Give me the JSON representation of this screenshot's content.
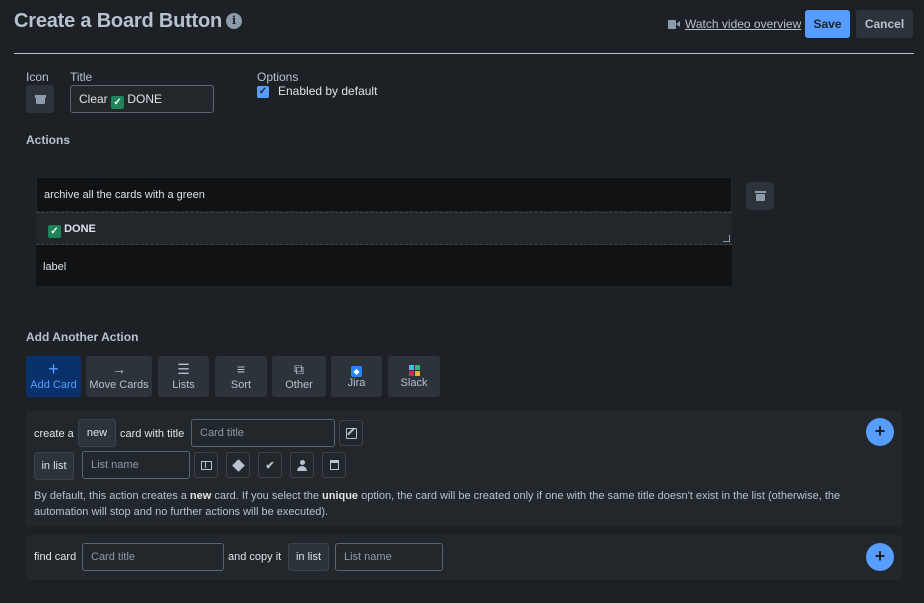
{
  "header": {
    "title": "Create a Board Button",
    "info_icon": "info-icon",
    "video_link": "Watch video overview",
    "save_label": "Save",
    "cancel_label": "Cancel"
  },
  "button_config": {
    "icon_label": "Icon",
    "icon_name": "archive-icon",
    "title_label": "Title",
    "title_value_prefix": "Clear",
    "title_value_suffix": "DONE",
    "options_label": "Options",
    "enabled_label": "Enabled by default",
    "enabled": true
  },
  "actions": {
    "heading": "Actions",
    "items": [
      {
        "line1": "archive all the cards with a green",
        "label_name": "DONE",
        "line3": "label"
      }
    ]
  },
  "add_action": {
    "heading": "Add Another Action",
    "tabs": [
      {
        "label": "Add Card",
        "icon": "plus-icon",
        "active": true
      },
      {
        "label": "Move Cards",
        "icon": "arrow-right-icon",
        "active": false
      },
      {
        "label": "Lists",
        "icon": "list-icon",
        "active": false
      },
      {
        "label": "Sort",
        "icon": "sort-icon",
        "active": false
      },
      {
        "label": "Other",
        "icon": "copy-icon",
        "active": false
      },
      {
        "label": "Jira",
        "icon": "jira-icon",
        "active": false
      },
      {
        "label": "Slack",
        "icon": "slack-icon",
        "active": false
      }
    ]
  },
  "create_card": {
    "text_create_a": "create a",
    "option_new": "new",
    "text_card_with_title": "card with title",
    "card_title_placeholder": "Card title",
    "in_list": "in list",
    "list_name_placeholder": "List name",
    "help_1": "By default, this action creates a ",
    "help_new": "new",
    "help_2": " card. If you select the ",
    "help_unique": "unique",
    "help_3": " option, the card will be created only if one with the same title doesn't exist in the list (otherwise, the automation will stop and no further actions will be executed)."
  },
  "find_card": {
    "text_find_card": "find card",
    "card_title_placeholder": "Card title",
    "text_and_copy_it": "and copy it",
    "in_list": "in list",
    "list_name_placeholder": "List name"
  },
  "colors": {
    "background": "#1d2125",
    "primary": "#579dff",
    "active_tab": "#09326c",
    "check_green": "#1f845a"
  }
}
